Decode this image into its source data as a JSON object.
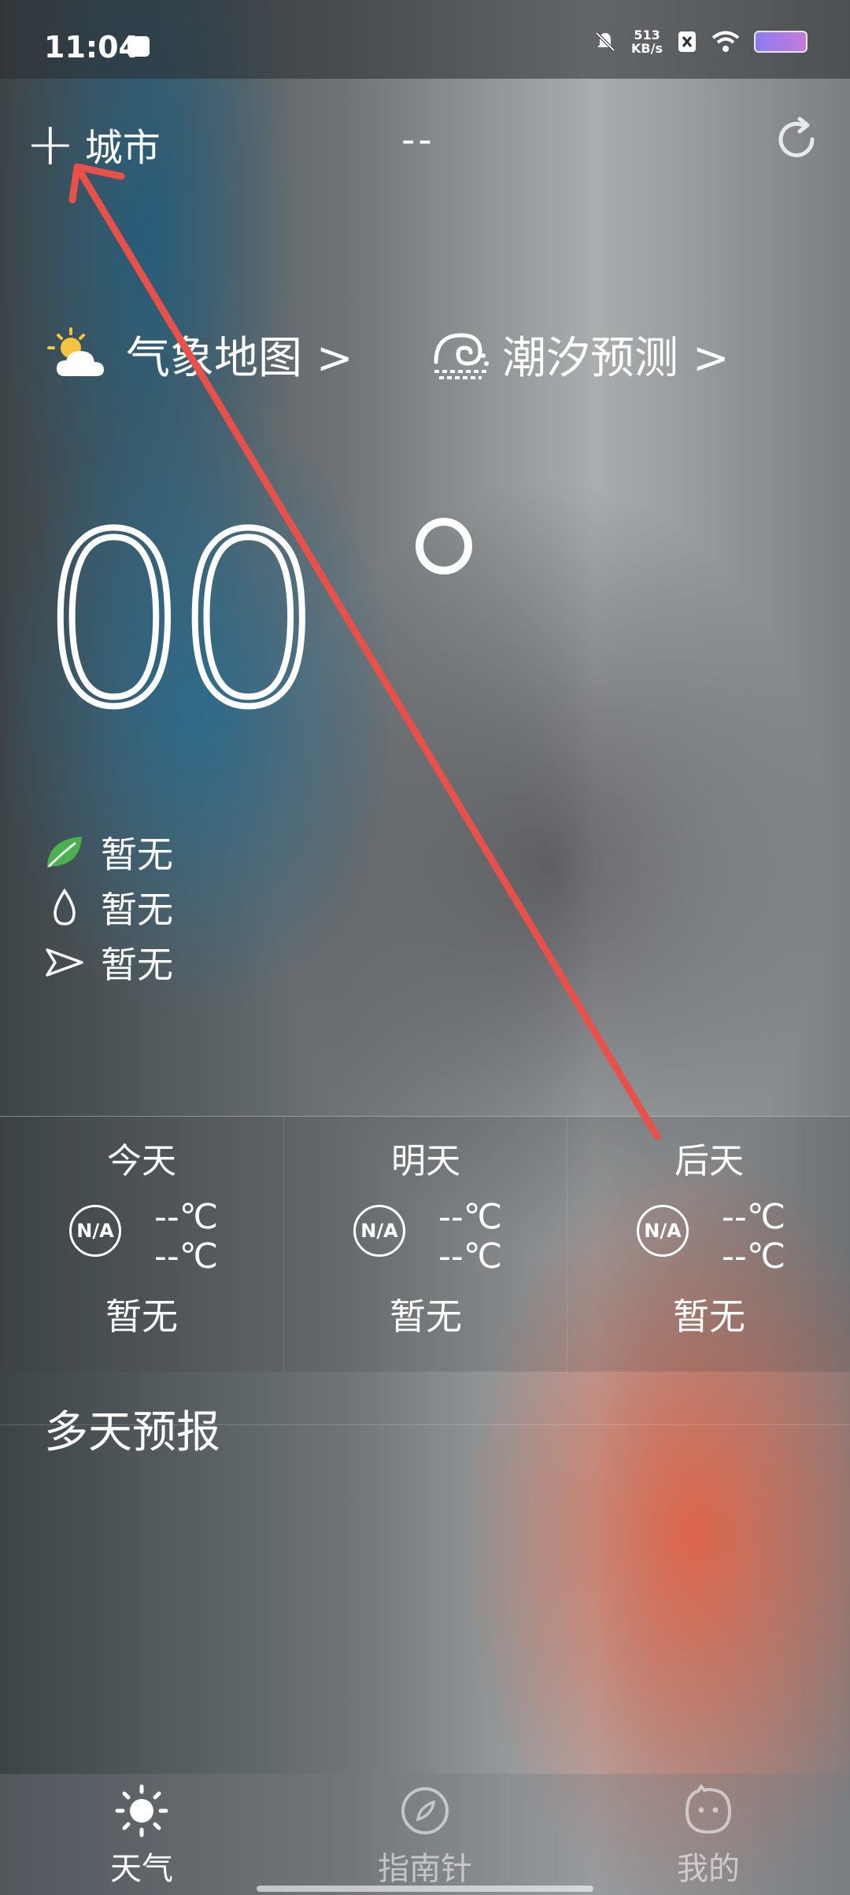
{
  "status_bar": {
    "time": "11:04",
    "net_speed_value": "513",
    "net_speed_unit": "KB/s"
  },
  "header": {
    "add_label": "城市",
    "title": "--"
  },
  "shortcuts": {
    "map_label": "气象地图 >",
    "tide_label": "潮汐预测 >"
  },
  "current": {
    "temperature": "00"
  },
  "details": {
    "air_quality": "暂无",
    "humidity": "暂无",
    "wind": "暂无"
  },
  "three_day": [
    {
      "label": "今天",
      "icon_text": "N/A",
      "high": "--℃",
      "low": "--℃",
      "weather": "暂无"
    },
    {
      "label": "明天",
      "icon_text": "N/A",
      "high": "--℃",
      "low": "--℃",
      "weather": "暂无"
    },
    {
      "label": "后天",
      "icon_text": "N/A",
      "high": "--℃",
      "low": "--℃",
      "weather": "暂无"
    }
  ],
  "multi_day": {
    "title": "多天预报"
  },
  "bottom_nav": [
    {
      "label": "天气",
      "icon": "sun-icon",
      "active": true
    },
    {
      "label": "指南针",
      "icon": "compass-icon",
      "active": false
    },
    {
      "label": "我的",
      "icon": "face-icon",
      "active": false
    }
  ],
  "colors": {
    "annotation_arrow": "#e8504a",
    "leaf_icon": "#4caf50"
  }
}
